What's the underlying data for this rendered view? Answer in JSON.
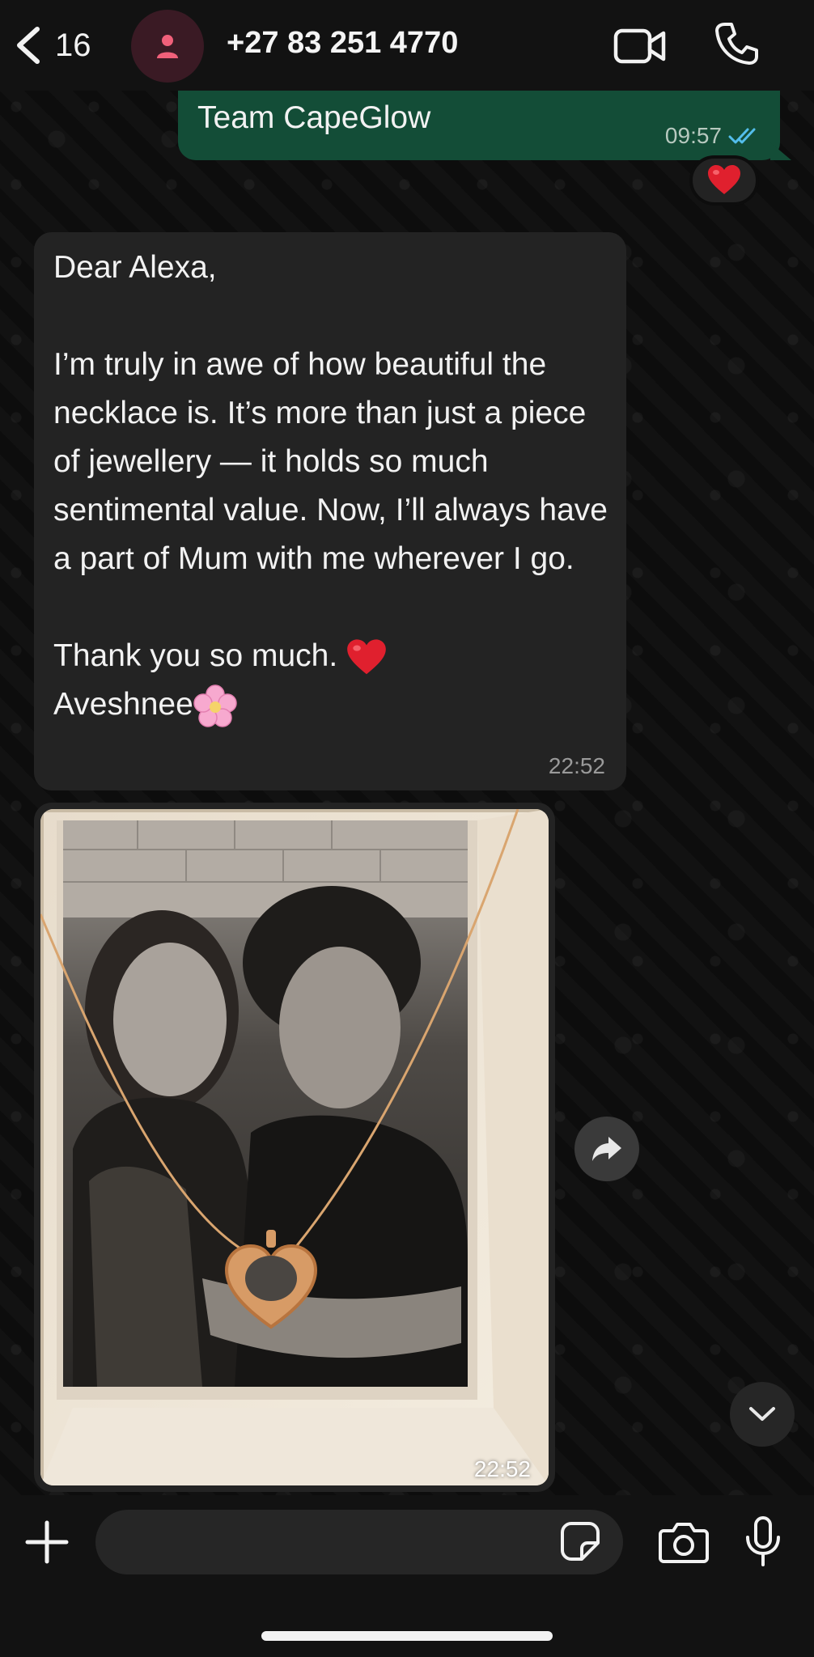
{
  "header": {
    "back_count": "16",
    "contact_name": "+27 83 251 4770",
    "icons": [
      "chevron-left-icon",
      "person-icon",
      "video-camera-icon",
      "phone-icon"
    ]
  },
  "messages": {
    "outgoing": {
      "text": "Team CapeGlow",
      "time": "09:57",
      "status": "read",
      "reaction": "❤️"
    },
    "incoming_text": {
      "line_1": "Dear Alexa,",
      "line_2": "I’m truly in awe of how beautiful the necklace is. It’s more than just a piece of jewellery — it holds so much sentimental value. Now, I’ll always have a part of Mum with me wherever I go.",
      "line_3": "Thank you so much. ",
      "line_3_emoji": "❤️",
      "line_4": "Aveshnee",
      "line_4_emoji": "🌸",
      "time": "22:52"
    },
    "incoming_photo": {
      "time": "22:52"
    }
  },
  "composer": {
    "placeholder": "",
    "icons": [
      "plus-icon",
      "sticker-icon",
      "camera-icon",
      "microphone-icon"
    ]
  },
  "colors": {
    "outgoing_bubble": "#134d37",
    "incoming_bubble": "#232323",
    "read_ticks": "#53bdeb",
    "background": "#0d0d0d"
  }
}
